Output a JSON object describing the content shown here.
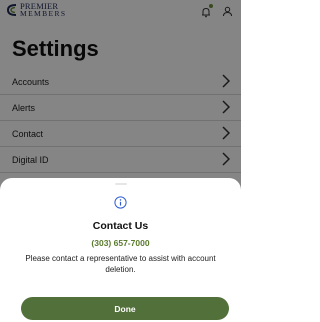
{
  "header": {
    "logo_line1": "PREMIER",
    "logo_line2": "MEMBERS"
  },
  "page": {
    "title": "Settings"
  },
  "menu": {
    "items": [
      {
        "label": "Accounts"
      },
      {
        "label": "Alerts"
      },
      {
        "label": "Contact"
      },
      {
        "label": "Digital ID"
      }
    ]
  },
  "dialog": {
    "title": "Contact Us",
    "phone": "(303) 657-7000",
    "message": "Please contact a representative to assist with account deletion.",
    "done_label": "Done"
  },
  "colors": {
    "accent": "#52703a",
    "phone": "#5a7a2c",
    "info_icon": "#2f5fd1",
    "logo": "#1e2a57"
  },
  "icons": {
    "logo": "premier-members-logo-icon",
    "notifications": "bell-icon",
    "profile": "person-icon",
    "chevron": "chevron-right-icon",
    "info": "info-icon"
  }
}
